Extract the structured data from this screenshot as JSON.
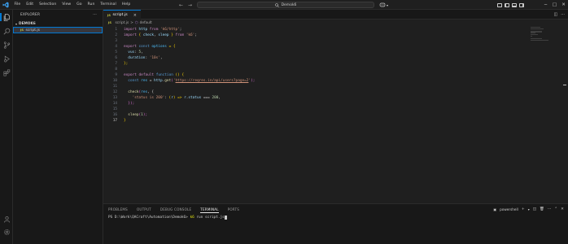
{
  "titlebar": {
    "menu": [
      "File",
      "Edit",
      "Selection",
      "View",
      "Go",
      "Run",
      "Terminal",
      "Help"
    ],
    "search": "Demok6"
  },
  "sidebar": {
    "title": "EXPLORER",
    "more": "···",
    "folder": "DEMOK6",
    "file_badge": "JS",
    "file": "script.js"
  },
  "editor": {
    "tab_badge": "JS",
    "tab_label": "script.js",
    "tab_close": "×",
    "breadcrumb_file": "script.js",
    "breadcrumb_sep": ">",
    "breadcrumb_symbol": "default",
    "line_numbers": [
      "1",
      "2",
      "3",
      "4",
      "5",
      "6",
      "7",
      "8",
      "9",
      "10",
      "11",
      "12",
      "13",
      "14",
      "15",
      "16",
      "17"
    ],
    "code": {
      "l1": {
        "kw": "import",
        "id": "http",
        "from": "from",
        "str": "'k6/http'",
        "end": ";"
      },
      "l2": {
        "kw": "import",
        "open": "{ ",
        "a": "check",
        "comma": ", ",
        "b": "sleep",
        "close": " }",
        "from": "from",
        "str": "'k6'",
        "end": ";"
      },
      "l4": {
        "exp": "export",
        "const": "const",
        "name": "options",
        "eq": " = {"
      },
      "l5": {
        "key": "vus",
        "colon": ": ",
        "num": "5",
        "end": ","
      },
      "l6": {
        "key": "duration",
        "colon": ": ",
        "str": "'10s'",
        "end": ","
      },
      "l7": {
        "text": "};"
      },
      "l9": {
        "exp": "export",
        "def": "default",
        "fn": "function",
        "parens": "()",
        "brace": " {"
      },
      "l10": {
        "const": "const",
        "name": "res",
        "eq": " = ",
        "obj": "http",
        "dot": ".",
        "method": "get",
        "open": "(",
        "q1": "'",
        "url": "https://reqres.in/api/users?page=2",
        "q2": "'",
        "close": ");"
      },
      "l12": {
        "fn": "check",
        "open": "(",
        "arg": "res",
        "rest": ", {"
      },
      "l13": {
        "str": "'status is 200'",
        "colon": ": ",
        "open": "(",
        "param": "r",
        "arrow": ") => ",
        "obj": "r",
        "dot": ".",
        "prop": "status",
        "op": " === ",
        "num": "200",
        "end": ","
      },
      "l14": {
        "text": "});"
      },
      "l16": {
        "fn": "sleep",
        "open": "(",
        "num": "1",
        "close": ");"
      },
      "l17": {
        "text": "}"
      }
    }
  },
  "panel": {
    "tabs": [
      "PROBLEMS",
      "OUTPUT",
      "DEBUG CONSOLE",
      "TERMINAL",
      "PORTS"
    ],
    "active_tab": "TERMINAL",
    "shell": "powershell",
    "prompt": "PS D:\\Work\\QACraft\\Automation\\Demok6> ",
    "command": "k6 run script.js"
  },
  "colors": {
    "accent": "#0078d4",
    "editor_bg": "#1f1f1f",
    "sidebar_bg": "#181818",
    "js_badge": "#cbcb41"
  },
  "icons": [
    "vscode-logo-icon",
    "explorer-icon",
    "search-icon",
    "source-control-icon",
    "run-debug-icon",
    "extensions-icon",
    "account-icon",
    "settings-gear-icon"
  ]
}
